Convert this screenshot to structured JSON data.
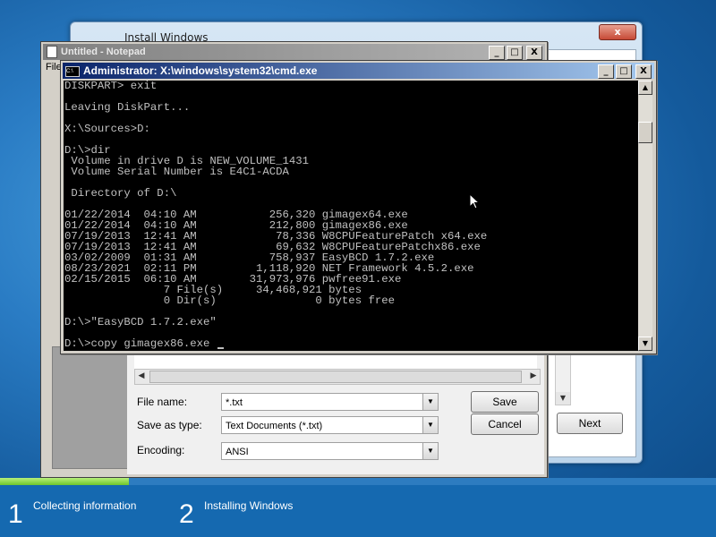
{
  "install_window": {
    "title": "Install Windows",
    "close_label": "x",
    "next_label": "Next"
  },
  "notepad": {
    "title": "Untitled - Notepad",
    "menu_fragment": "File",
    "minimize": "_",
    "maximize": "□",
    "close": "X"
  },
  "save_dialog": {
    "file_name_label": "File name:",
    "file_name_value": "*.txt",
    "save_as_type_label": "Save as type:",
    "save_as_type_value": "Text Documents (*.txt)",
    "encoding_label": "Encoding:",
    "encoding_value": "ANSI",
    "save_button": "Save",
    "cancel_button": "Cancel"
  },
  "cmd": {
    "title": "Administrator: X:\\windows\\system32\\cmd.exe",
    "icon_text": "C:\\",
    "minimize": "_",
    "maximize": "□",
    "close": "X",
    "lines": [
      "DISKPART> exit",
      "",
      "Leaving DiskPart...",
      "",
      "X:\\Sources>D:",
      "",
      "D:\\>dir",
      " Volume in drive D is NEW_VOLUME_1431",
      " Volume Serial Number is E4C1-ACDA",
      "",
      " Directory of D:\\",
      "",
      "01/22/2014  04:10 AM           256,320 gimagex64.exe",
      "01/22/2014  04:10 AM           212,800 gimagex86.exe",
      "07/19/2013  12:41 AM            78,336 W8CPUFeaturePatch x64.exe",
      "07/19/2013  12:41 AM            69,632 W8CPUFeaturePatchx86.exe",
      "03/02/2009  01:31 AM           758,937 EasyBCD 1.7.2.exe",
      "08/23/2021  02:11 PM         1,118,920 NET Framework 4.5.2.exe",
      "02/15/2015  06:10 AM        31,973,976 pwfree91.exe",
      "               7 File(s)     34,468,921 bytes",
      "               0 Dir(s)               0 bytes free",
      "",
      "D:\\>\"EasyBCD 1.7.2.exe\"",
      "",
      "D:\\>copy gimagex86.exe "
    ]
  },
  "setup_steps": {
    "progress": 0.18,
    "steps": [
      {
        "number": "1",
        "label": "Collecting information"
      },
      {
        "number": "2",
        "label": "Installing Windows"
      }
    ]
  },
  "colors": {
    "console_text": "#c0c0c0",
    "console_bg": "#000000",
    "active_title": "#0a246a",
    "progress_fill": "#6fc62c"
  }
}
